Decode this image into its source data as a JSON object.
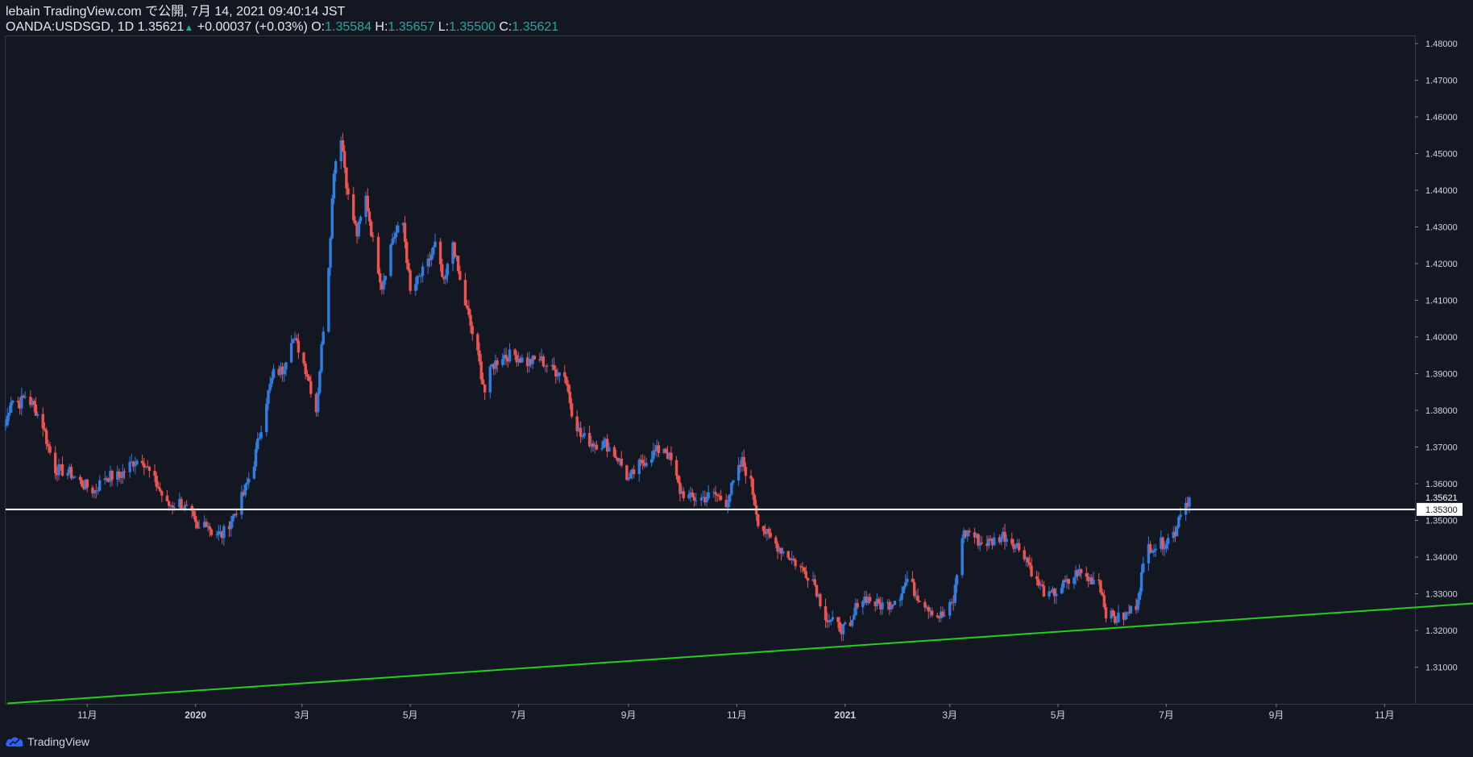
{
  "header": {
    "published_line": "lebain TradingView.com で公開, 7月 14, 2021 09:40:14 JST",
    "symbol_interval": "OANDA:USDSGD, 1D",
    "last_price": "1.35621",
    "arrow": "▲",
    "change": "+0.00037 (+0.03%)",
    "o_label": "O:",
    "o_value": "1.35584",
    "h_label": "H:",
    "h_value": "1.35657",
    "l_label": "L:",
    "l_value": "1.35500",
    "c_label": "C:",
    "c_value": "1.35621"
  },
  "footer": {
    "brand": "TradingView",
    "logo_icon": "tradingview-cloud-icon"
  },
  "colors": {
    "background": "#131722",
    "up": "#2f7de1",
    "down": "#ef5350",
    "horizontal_line": "#ffffff",
    "trend_line": "#22d01d",
    "axis_text": "#d1d4dc"
  },
  "chart_data": {
    "type": "candlestick",
    "symbol": "OANDA:USDSGD",
    "interval": "1D",
    "date_range": [
      "2019-09-16",
      "2021-07-14"
    ],
    "y_axis": {
      "range": [
        1.3,
        1.482
      ],
      "ticks": [
        "1.48000",
        "1.47000",
        "1.46000",
        "1.45000",
        "1.44000",
        "1.43000",
        "1.42000",
        "1.41000",
        "1.40000",
        "1.39000",
        "1.38000",
        "1.37000",
        "1.36000",
        "1.35000",
        "1.34000",
        "1.33000",
        "1.32000",
        "1.31000"
      ],
      "last_price_label": "1.35621",
      "level_label": "1.35300"
    },
    "x_axis": {
      "ticks": [
        {
          "label": "11月",
          "date": "2019-11-01",
          "bold": false
        },
        {
          "label": "2020",
          "date": "2020-01-01",
          "bold": true
        },
        {
          "label": "3月",
          "date": "2020-03-01",
          "bold": false
        },
        {
          "label": "5月",
          "date": "2020-05-01",
          "bold": false
        },
        {
          "label": "7月",
          "date": "2020-07-01",
          "bold": false
        },
        {
          "label": "9月",
          "date": "2020-09-01",
          "bold": false
        },
        {
          "label": "11月",
          "date": "2020-11-01",
          "bold": false
        },
        {
          "label": "2021",
          "date": "2021-01-01",
          "bold": true
        },
        {
          "label": "3月",
          "date": "2021-03-01",
          "bold": false
        },
        {
          "label": "5月",
          "date": "2021-05-01",
          "bold": false
        },
        {
          "label": "7月",
          "date": "2021-07-01",
          "bold": false
        },
        {
          "label": "9月",
          "date": "2021-09-01",
          "bold": false
        },
        {
          "label": "11月",
          "date": "2021-11-01",
          "bold": false
        }
      ]
    },
    "close_path": [
      [
        "2019-09-16",
        1.376
      ],
      [
        "2019-09-19",
        1.383
      ],
      [
        "2019-09-24",
        1.382
      ],
      [
        "2019-09-27",
        1.384
      ],
      [
        "2019-10-02",
        1.381
      ],
      [
        "2019-10-07",
        1.376
      ],
      [
        "2019-10-10",
        1.37
      ],
      [
        "2019-10-14",
        1.364
      ],
      [
        "2019-10-22",
        1.363
      ],
      [
        "2019-10-29",
        1.36
      ],
      [
        "2019-11-05",
        1.358
      ],
      [
        "2019-11-11",
        1.362
      ],
      [
        "2019-11-19",
        1.362
      ],
      [
        "2019-11-27",
        1.366
      ],
      [
        "2019-12-02",
        1.367
      ],
      [
        "2019-12-06",
        1.363
      ],
      [
        "2019-12-11",
        1.359
      ],
      [
        "2019-12-16",
        1.354
      ],
      [
        "2019-12-23",
        1.355
      ],
      [
        "2019-12-30",
        1.351
      ],
      [
        "2020-01-02",
        1.347
      ],
      [
        "2020-01-07",
        1.35
      ],
      [
        "2020-01-10",
        1.347
      ],
      [
        "2020-01-16",
        1.346
      ],
      [
        "2020-01-22",
        1.351
      ],
      [
        "2020-01-28",
        1.357
      ],
      [
        "2020-02-03",
        1.366
      ],
      [
        "2020-02-10",
        1.383
      ],
      [
        "2020-02-14",
        1.39
      ],
      [
        "2020-02-19",
        1.391
      ],
      [
        "2020-02-24",
        1.4
      ],
      [
        "2020-02-28",
        1.397
      ],
      [
        "2020-03-04",
        1.39
      ],
      [
        "2020-03-09",
        1.38
      ],
      [
        "2020-03-12",
        1.397
      ],
      [
        "2020-03-16",
        1.42
      ],
      [
        "2020-03-19",
        1.446
      ],
      [
        "2020-03-23",
        1.455
      ],
      [
        "2020-03-27",
        1.438
      ],
      [
        "2020-04-01",
        1.428
      ],
      [
        "2020-04-06",
        1.438
      ],
      [
        "2020-04-10",
        1.426
      ],
      [
        "2020-04-15",
        1.414
      ],
      [
        "2020-04-21",
        1.427
      ],
      [
        "2020-04-27",
        1.431
      ],
      [
        "2020-05-01",
        1.412
      ],
      [
        "2020-05-06",
        1.416
      ],
      [
        "2020-05-11",
        1.42
      ],
      [
        "2020-05-15",
        1.425
      ],
      [
        "2020-05-20",
        1.414
      ],
      [
        "2020-05-25",
        1.426
      ],
      [
        "2020-05-29",
        1.415
      ],
      [
        "2020-06-03",
        1.405
      ],
      [
        "2020-06-08",
        1.395
      ],
      [
        "2020-06-12",
        1.385
      ],
      [
        "2020-06-16",
        1.392
      ],
      [
        "2020-06-22",
        1.395
      ],
      [
        "2020-06-29",
        1.395
      ],
      [
        "2020-07-06",
        1.393
      ],
      [
        "2020-07-13",
        1.394
      ],
      [
        "2020-07-20",
        1.391
      ],
      [
        "2020-07-27",
        1.39
      ],
      [
        "2020-07-31",
        1.38
      ],
      [
        "2020-08-05",
        1.373
      ],
      [
        "2020-08-12",
        1.371
      ],
      [
        "2020-08-19",
        1.371
      ],
      [
        "2020-08-26",
        1.367
      ],
      [
        "2020-09-01",
        1.361
      ],
      [
        "2020-09-07",
        1.365
      ],
      [
        "2020-09-14",
        1.368
      ],
      [
        "2020-09-21",
        1.37
      ],
      [
        "2020-09-25",
        1.366
      ],
      [
        "2020-09-30",
        1.358
      ],
      [
        "2020-10-06",
        1.356
      ],
      [
        "2020-10-12",
        1.356
      ],
      [
        "2020-10-20",
        1.357
      ],
      [
        "2020-10-26",
        1.355
      ],
      [
        "2020-10-30",
        1.36
      ],
      [
        "2020-11-04",
        1.366
      ],
      [
        "2020-11-09",
        1.36
      ],
      [
        "2020-11-13",
        1.35
      ],
      [
        "2020-11-18",
        1.346
      ],
      [
        "2020-11-24",
        1.343
      ],
      [
        "2020-12-01",
        1.34
      ],
      [
        "2020-12-07",
        1.337
      ],
      [
        "2020-12-14",
        1.334
      ],
      [
        "2020-12-18",
        1.328
      ],
      [
        "2020-12-22",
        1.323
      ],
      [
        "2020-12-28",
        1.321
      ],
      [
        "2021-01-04",
        1.32
      ],
      [
        "2021-01-08",
        1.328
      ],
      [
        "2021-01-13",
        1.329
      ],
      [
        "2021-01-19",
        1.327
      ],
      [
        "2021-01-25",
        1.327
      ],
      [
        "2021-02-01",
        1.33
      ],
      [
        "2021-02-05",
        1.334
      ],
      [
        "2021-02-10",
        1.33
      ],
      [
        "2021-02-16",
        1.327
      ],
      [
        "2021-02-22",
        1.324
      ],
      [
        "2021-02-26",
        1.324
      ],
      [
        "2021-03-03",
        1.328
      ],
      [
        "2021-03-08",
        1.346
      ],
      [
        "2021-03-12",
        1.347
      ],
      [
        "2021-03-18",
        1.344
      ],
      [
        "2021-03-24",
        1.344
      ],
      [
        "2021-03-31",
        1.346
      ],
      [
        "2021-04-06",
        1.344
      ],
      [
        "2021-04-12",
        1.341
      ],
      [
        "2021-04-19",
        1.333
      ],
      [
        "2021-04-26",
        1.329
      ],
      [
        "2021-05-03",
        1.332
      ],
      [
        "2021-05-07",
        1.333
      ],
      [
        "2021-05-12",
        1.336
      ],
      [
        "2021-05-18",
        1.334
      ],
      [
        "2021-05-24",
        1.334
      ],
      [
        "2021-05-28",
        1.325
      ],
      [
        "2021-06-02",
        1.323
      ],
      [
        "2021-06-08",
        1.324
      ],
      [
        "2021-06-14",
        1.327
      ],
      [
        "2021-06-17",
        1.335
      ],
      [
        "2021-06-21",
        1.343
      ],
      [
        "2021-06-25",
        1.343
      ],
      [
        "2021-06-30",
        1.344
      ],
      [
        "2021-07-06",
        1.347
      ],
      [
        "2021-07-09",
        1.353
      ],
      [
        "2021-07-14",
        1.356
      ]
    ],
    "horizontal_level": {
      "price": 1.353
    },
    "trend_line": {
      "from": [
        "2019-09-17",
        1.3001
      ],
      "to": [
        "2021-12-31",
        1.3277
      ]
    }
  }
}
